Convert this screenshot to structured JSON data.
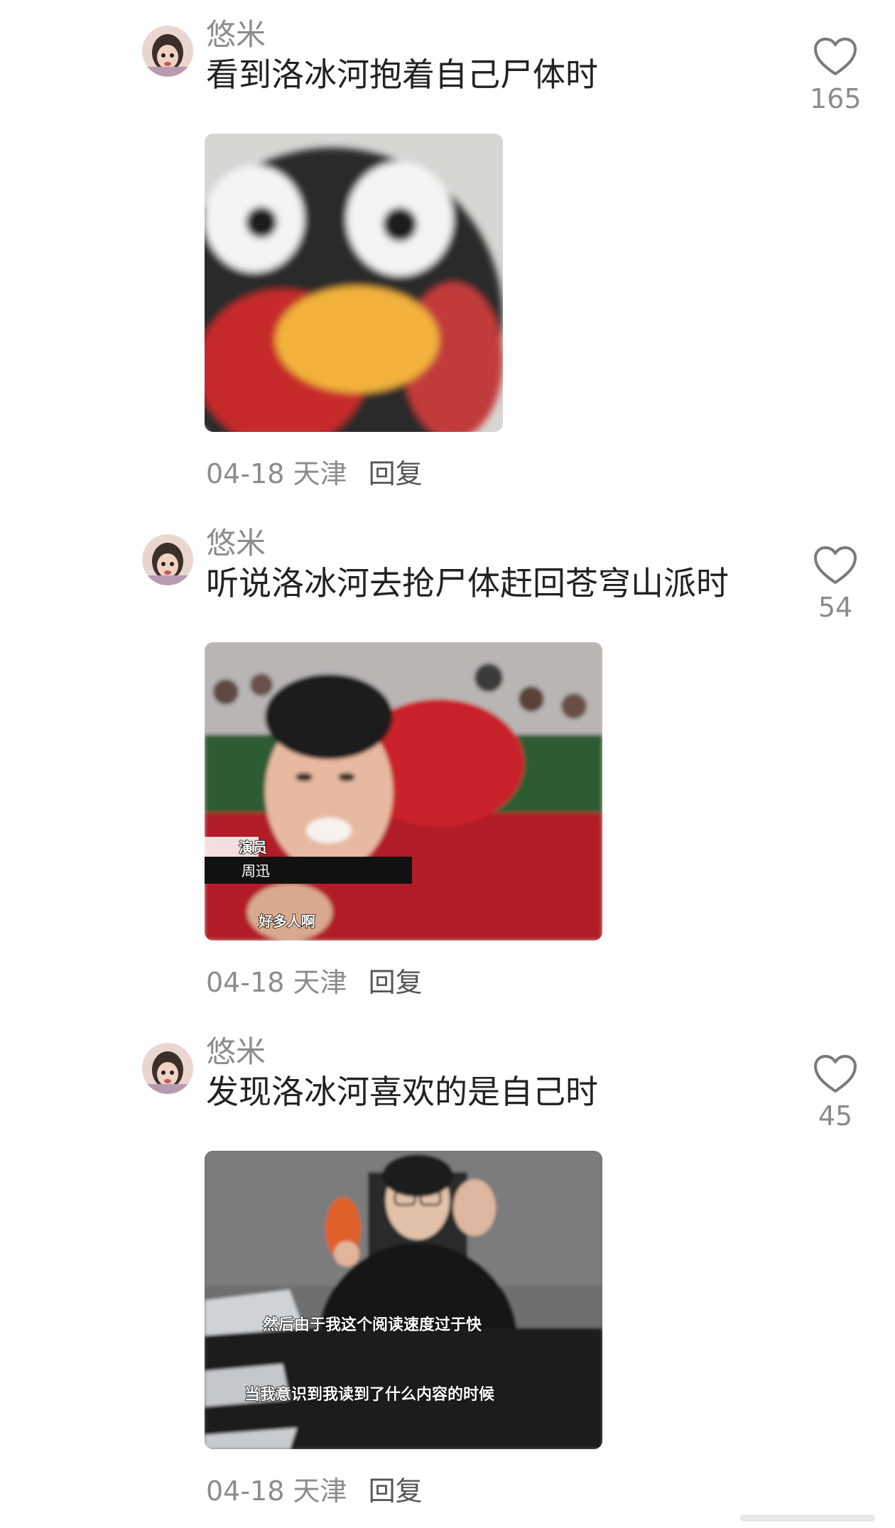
{
  "comments": [
    {
      "username": "悠米",
      "text": "看到洛冰河抱着自己尸体时",
      "date": "04-18",
      "location": "天津",
      "reply_label": "回复",
      "likes": "165",
      "media": {
        "kind": "penguin-meme-image"
      }
    },
    {
      "username": "悠米",
      "text": "听说洛冰河去抢尸体赶回苍穹山派时",
      "date": "04-18",
      "location": "天津",
      "reply_label": "回复",
      "likes": "54",
      "media": {
        "kind": "actress-video-screenshot",
        "caption_role": "演员",
        "caption_name": "周迅",
        "subtitle": "好多人啊"
      }
    },
    {
      "username": "悠米",
      "text": "发现洛冰河喜欢的是自己时",
      "date": "04-18",
      "location": "天津",
      "reply_label": "回复",
      "likes": "45",
      "media": {
        "kind": "reading-video-screenshot",
        "subtitle_1": "然后由于我这个阅读速度过于快",
        "subtitle_2": "当我意识到我读到了什么内容的时候"
      }
    }
  ],
  "icons": {
    "like": "heart-outline-icon",
    "avatar": "user-avatar"
  },
  "colors": {
    "secondary_text": "#8c8c8c",
    "primary_text": "#222222",
    "icon_stroke": "#7a7a7a"
  }
}
